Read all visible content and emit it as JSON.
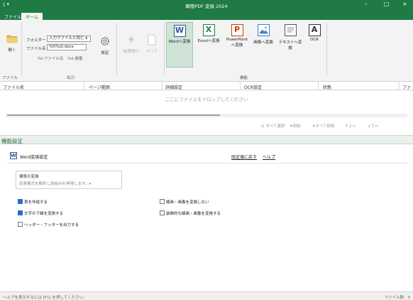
{
  "window": {
    "title": "瞬簡PDF 変換 2024",
    "quick_access": "▯ ▾",
    "minimize": "–",
    "maximize": "□",
    "close": "×"
  },
  "tabs": [
    {
      "label": "ファイル",
      "active": false
    },
    {
      "label": "ホーム",
      "active": true
    }
  ],
  "ribbon": {
    "file_group": {
      "open_label": "開く",
      "group_label": "ファイル"
    },
    "output_group": {
      "folder_label": "フォルダー",
      "folder_value": "入力ファイルと同じ ▾",
      "filename_label": "ファイル名",
      "filename_value": "%f(%d).docx",
      "filename_hint": "%f:ファイル名　%d:連番",
      "settings_label": "設定",
      "group_label": "出力"
    },
    "process_group": {
      "run_label": "処理実行",
      "clear_label": "クリア"
    },
    "function_group": {
      "group_label": "機能",
      "buttons": [
        {
          "icon_letter": "W",
          "label": "Wordへ変換",
          "color": "#2b5797",
          "selected": true
        },
        {
          "icon_letter": "X",
          "label": "Excelへ変換",
          "color": "#1f7a45",
          "selected": false
        },
        {
          "icon_letter": "P",
          "label": "PowerPoint へ変換",
          "color": "#c2410c",
          "selected": false
        },
        {
          "icon_letter": "",
          "label": "画像へ変換",
          "color": "#3b82c4",
          "selected": false
        },
        {
          "icon_letter": "",
          "label": "テキストへ変換",
          "color": "#555555",
          "selected": false
        },
        {
          "icon_letter": "A",
          "label": "OCR",
          "color": "#333333",
          "selected": false
        }
      ]
    }
  },
  "table": {
    "columns": [
      "ファイル名",
      "ページ範囲",
      "詳細設定",
      "OCR設定",
      "状態",
      "ファ"
    ],
    "drop_message": "ここにファイルをドロップしてください",
    "actions": [
      "すべて選択",
      "削除",
      "すべて削除",
      "上へ",
      "下へ"
    ]
  },
  "feature_panel": {
    "title": "機能設定",
    "subtitle": "Word変換設定",
    "reset_link": "既定値に戻す",
    "help_link": "ヘルプ",
    "conversion_title": "標準の変換",
    "conversion_desc": "段落書式を解析し段組みを再現します。▾",
    "options": [
      {
        "label": "表を作成する",
        "checked": true
      },
      {
        "label": "文字の下線を変換する",
        "checked": true
      },
      {
        "label": "ヘッダー・フッターを出力する",
        "checked": false
      },
      {
        "label": "線画・画像を変換しない",
        "checked": false
      },
      {
        "label": "装飾的な線画・画像を変換する",
        "checked": false
      }
    ]
  },
  "status": {
    "left": "ヘルプを表示するには [F1] を押してください。",
    "right": "ファイル数：0"
  }
}
